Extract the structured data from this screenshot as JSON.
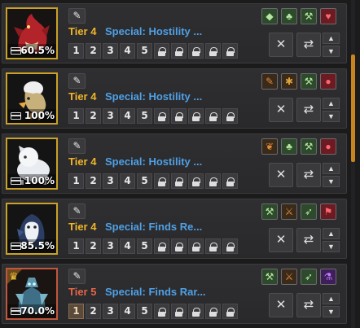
{
  "items": [
    {
      "tier": "Tier 4",
      "special": "Special: Hostility ...",
      "percent": "60.5%",
      "creature_icon": "red-dragon",
      "levels": [
        "1",
        "2",
        "3",
        "4",
        "5"
      ],
      "skill_icons": [
        "fish-skill-icon",
        "clover-skill-icon",
        "pickaxe-skill-icon",
        "heart-skill-icon"
      ]
    },
    {
      "tier": "Tier 4",
      "special": "Special: Hostility ...",
      "percent": "100%",
      "creature_icon": "egg-chick",
      "levels": [
        "1",
        "2",
        "3",
        "4",
        "5"
      ],
      "skill_icons": [
        "branch-skill-icon",
        "wasp-skill-icon",
        "pickaxe-skill-icon",
        "meat-skill-icon"
      ]
    },
    {
      "tier": "Tier 4",
      "special": "Special: Hostility ...",
      "percent": "100%",
      "creature_icon": "white-beast",
      "levels": [
        "1",
        "2",
        "3",
        "4",
        "5"
      ],
      "skill_icons": [
        "leaf-skill-icon",
        "clover-skill-icon",
        "pickaxe-skill-icon",
        "meat-skill-icon"
      ]
    },
    {
      "tier": "Tier 4",
      "special": "Special: Finds Re...",
      "percent": "85.5%",
      "creature_icon": "hooded-penguin",
      "levels": [
        "1",
        "2",
        "3",
        "4",
        "5"
      ],
      "skill_icons": [
        "pickaxe-skill-icon",
        "axe-skill-icon",
        "feather-skill-icon",
        "shovel-skill-icon"
      ]
    },
    {
      "tier": "Tier 5",
      "special": "Special: Finds Rar...",
      "percent": "70.0%",
      "creature_icon": "ice-golem",
      "crowned": true,
      "levels": [
        "1",
        "2",
        "3",
        "4",
        "5"
      ],
      "active_level": "1",
      "skill_icons": [
        "pickaxe-skill-icon",
        "axe-skill-icon",
        "feather-skill-icon",
        "potion-skill-icon"
      ]
    }
  ],
  "colors": {
    "tier4": "#f1b52a",
    "tier5": "#e46548",
    "special": "#4fa0e6",
    "scrollbar": "#c8841f"
  }
}
